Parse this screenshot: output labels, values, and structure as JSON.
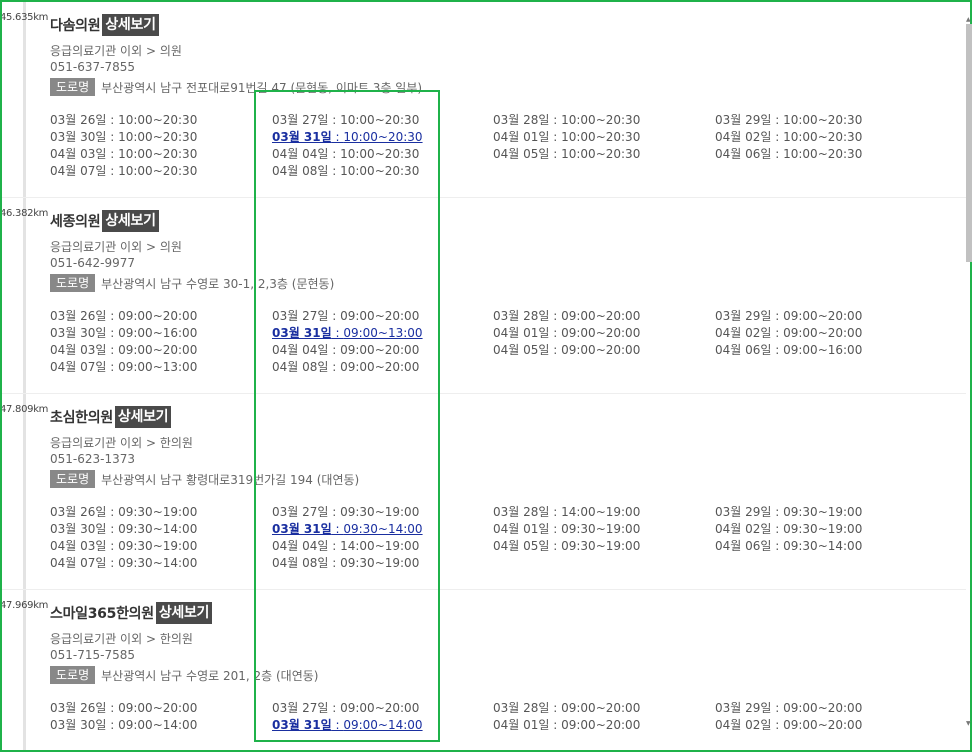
{
  "labels": {
    "detail": "상세보기",
    "road": "도로명"
  },
  "clinics": [
    {
      "distance": "45.635km",
      "name": "다솜의원",
      "category": "응급의료기관 이외 > 의원",
      "phone": "051-637-7855",
      "address": "부산광역시 남구 전포대로91번길 47 (문현동, 이마트 3층 일부)",
      "hours": [
        [
          "03월 26일",
          "10:00~20:30"
        ],
        [
          "03월 27일",
          "10:00~20:30"
        ],
        [
          "03월 28일",
          "10:00~20:30"
        ],
        [
          "03월 29일",
          "10:00~20:30"
        ],
        [
          "03월 30일",
          "10:00~20:30"
        ],
        [
          "03월 31일",
          "10:00~20:30"
        ],
        [
          "04월 01일",
          "10:00~20:30"
        ],
        [
          "04월 02일",
          "10:00~20:30"
        ],
        [
          "04월 03일",
          "10:00~20:30"
        ],
        [
          "04월 04일",
          "10:00~20:30"
        ],
        [
          "04월 05일",
          "10:00~20:30"
        ],
        [
          "04월 06일",
          "10:00~20:30"
        ],
        [
          "04월 07일",
          "10:00~20:30"
        ],
        [
          "04월 08일",
          "10:00~20:30"
        ]
      ]
    },
    {
      "distance": "46.382km",
      "name": "세종의원",
      "category": "응급의료기관 이외 > 의원",
      "phone": "051-642-9977",
      "address": "부산광역시 남구 수영로 30-1, 2,3층 (문현동)",
      "hours": [
        [
          "03월 26일",
          "09:00~20:00"
        ],
        [
          "03월 27일",
          "09:00~20:00"
        ],
        [
          "03월 28일",
          "09:00~20:00"
        ],
        [
          "03월 29일",
          "09:00~20:00"
        ],
        [
          "03월 30일",
          "09:00~16:00"
        ],
        [
          "03월 31일",
          "09:00~13:00"
        ],
        [
          "04월 01일",
          "09:00~20:00"
        ],
        [
          "04월 02일",
          "09:00~20:00"
        ],
        [
          "04월 03일",
          "09:00~20:00"
        ],
        [
          "04월 04일",
          "09:00~20:00"
        ],
        [
          "04월 05일",
          "09:00~20:00"
        ],
        [
          "04월 06일",
          "09:00~16:00"
        ],
        [
          "04월 07일",
          "09:00~13:00"
        ],
        [
          "04월 08일",
          "09:00~20:00"
        ]
      ]
    },
    {
      "distance": "47.809km",
      "name": "초심한의원",
      "category": "응급의료기관 이외 > 한의원",
      "phone": "051-623-1373",
      "address": "부산광역시 남구 황령대로319번가길 194 (대연동)",
      "hours": [
        [
          "03월 26일",
          "09:30~19:00"
        ],
        [
          "03월 27일",
          "09:30~19:00"
        ],
        [
          "03월 28일",
          "14:00~19:00"
        ],
        [
          "03월 29일",
          "09:30~19:00"
        ],
        [
          "03월 30일",
          "09:30~14:00"
        ],
        [
          "03월 31일",
          "09:30~14:00"
        ],
        [
          "04월 01일",
          "09:30~19:00"
        ],
        [
          "04월 02일",
          "09:30~19:00"
        ],
        [
          "04월 03일",
          "09:30~19:00"
        ],
        [
          "04월 04일",
          "14:00~19:00"
        ],
        [
          "04월 05일",
          "09:30~19:00"
        ],
        [
          "04월 06일",
          "09:30~14:00"
        ],
        [
          "04월 07일",
          "09:30~14:00"
        ],
        [
          "04월 08일",
          "09:30~19:00"
        ]
      ]
    },
    {
      "distance": "47.969km",
      "name": "스마일365한의원",
      "category": "응급의료기관 이외 > 한의원",
      "phone": "051-715-7585",
      "address": "부산광역시 남구 수영로 201, 2층 (대연동)",
      "hours": [
        [
          "03월 26일",
          "09:00~20:00"
        ],
        [
          "03월 27일",
          "09:00~20:00"
        ],
        [
          "03월 28일",
          "09:00~20:00"
        ],
        [
          "03월 29일",
          "09:00~20:00"
        ],
        [
          "03월 30일",
          "09:00~14:00"
        ],
        [
          "03월 31일",
          "09:00~14:00"
        ],
        [
          "04월 01일",
          "09:00~20:00"
        ],
        [
          "04월 02일",
          "09:00~20:00"
        ]
      ]
    }
  ],
  "highlighted_date": "03월 31일"
}
